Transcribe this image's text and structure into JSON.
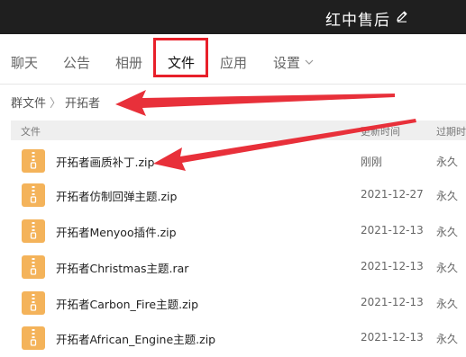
{
  "header": {
    "title": "红中售后"
  },
  "tabs": [
    {
      "label": "聊天"
    },
    {
      "label": "公告"
    },
    {
      "label": "相册"
    },
    {
      "label": "文件"
    },
    {
      "label": "应用"
    },
    {
      "label": "设置"
    }
  ],
  "breadcrumb": {
    "root": "群文件",
    "current": "开拓者"
  },
  "table": {
    "col_file": "文件",
    "col_time": "更新时间",
    "col_expire": "过期时"
  },
  "files": [
    {
      "name": "开拓者画质补丁.zip",
      "time": "刚刚",
      "expire": "永久"
    },
    {
      "name": "开拓者仿制回弹主题.zip",
      "time": "2021-12-27",
      "expire": "永久"
    },
    {
      "name": "开拓者Menyoo插件.zip",
      "time": "2021-12-13",
      "expire": "永久"
    },
    {
      "name": "开拓者Christmas主题.rar",
      "time": "2021-12-13",
      "expire": "永久"
    },
    {
      "name": "开拓者Carbon_Fire主题.zip",
      "time": "2021-12-13",
      "expire": "永久"
    },
    {
      "name": "开拓者African_Engine主题.zip",
      "time": "2021-12-13",
      "expire": "永久"
    }
  ],
  "colors": {
    "header_bg": "#1f1f1f",
    "highlight": "#e8202a",
    "arrow": "#e8303a",
    "file_icon": "#f4b35a"
  },
  "icons": [
    "edit-icon",
    "chevron-down-icon",
    "zip-file-icon",
    "breadcrumb-separator-icon"
  ]
}
